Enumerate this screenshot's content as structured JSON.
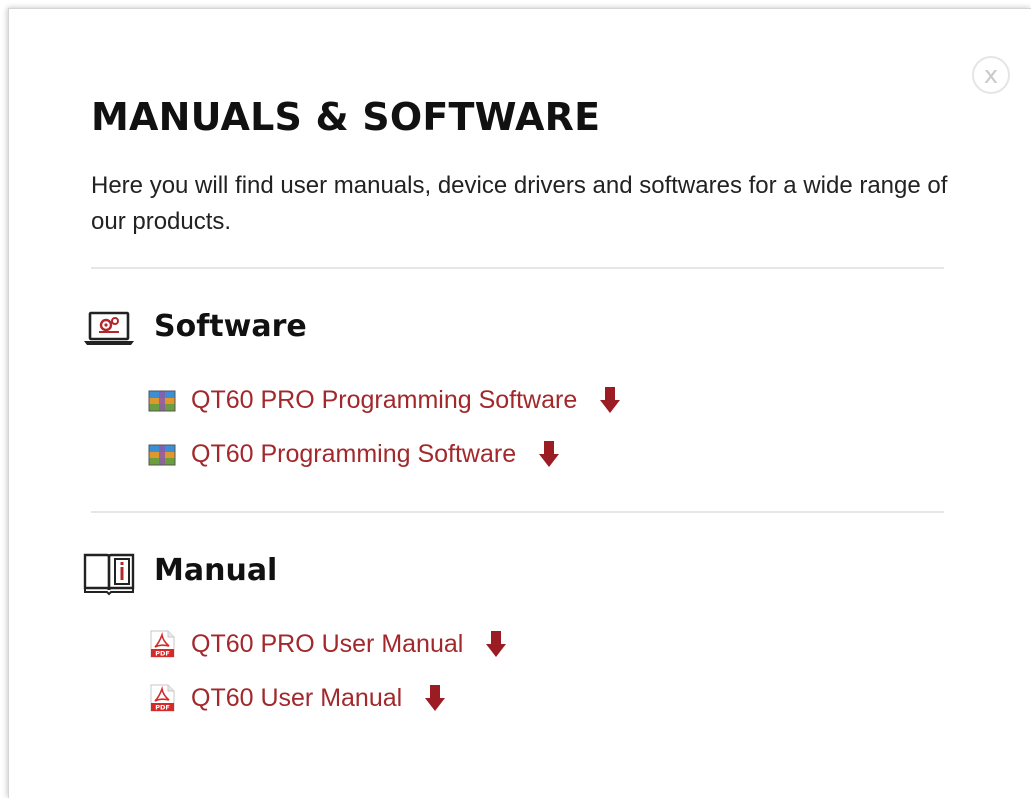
{
  "modal": {
    "close_label": "x",
    "title": "MANUALS & SOFTWARE",
    "intro": "Here you will find user manuals, device drivers and softwares for a wide range of our products."
  },
  "colors": {
    "link": "#a2282c",
    "download_arrow": "#9b1c22",
    "heading": "#111111",
    "divider": "#e6e6e6"
  },
  "sections": {
    "software": {
      "icon": "laptop-settings-icon",
      "title": "Software",
      "items": [
        {
          "label": "QT60 PRO Programming Software",
          "icon": "archive-file-icon"
        },
        {
          "label": "QT60 Programming Software",
          "icon": "archive-file-icon"
        }
      ]
    },
    "manual": {
      "icon": "info-book-icon",
      "title": "Manual",
      "items": [
        {
          "label": "QT60 PRO User Manual",
          "icon": "pdf-file-icon"
        },
        {
          "label": "QT60 User Manual",
          "icon": "pdf-file-icon"
        }
      ]
    }
  }
}
